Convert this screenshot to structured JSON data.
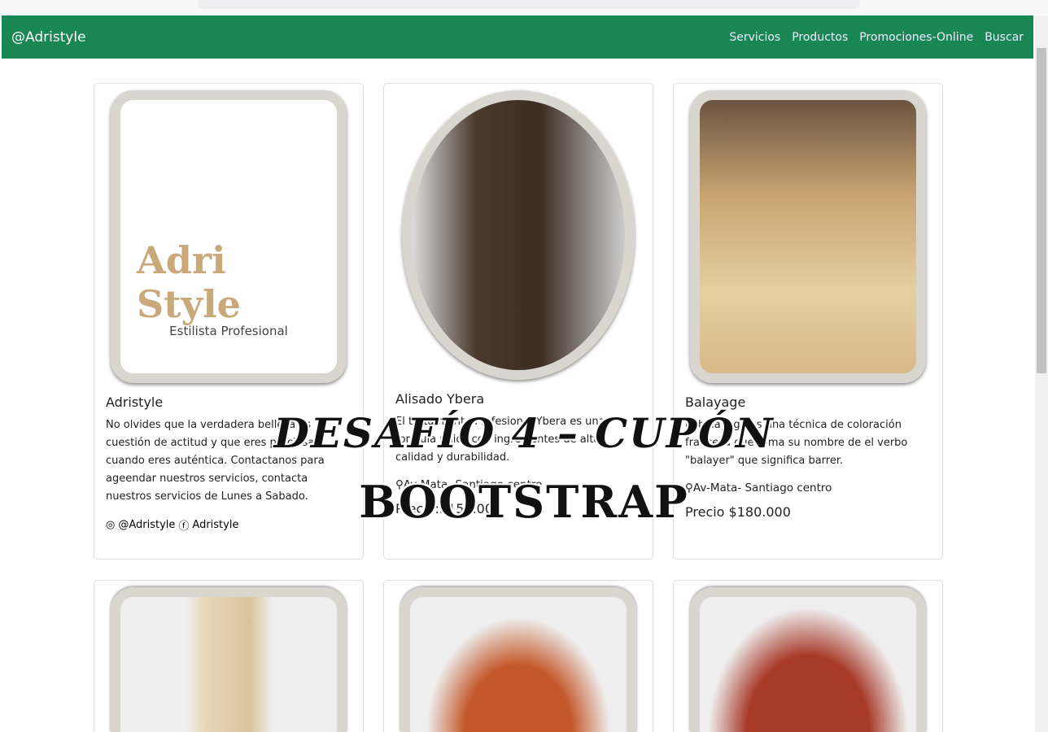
{
  "navbar": {
    "brand": "@Adristyle",
    "links": [
      "Servicios",
      "Productos",
      "Promociones-Online",
      "Buscar"
    ],
    "color": "#198754"
  },
  "cards": [
    {
      "title": "Adristyle",
      "text": "No olvides que la verdadera belleza es cuestión de actitud y que eres preciosa cuando eres auténtica. Contactanos para ageendar nuestros servicios, contacta nuestros servicios de Lunes a Sabado.",
      "instagram": "@Adristyle",
      "facebook": "Adristyle",
      "logo_text": "Adri Style",
      "logo_sub": "Estilista Profesional"
    },
    {
      "title": "Alisado Ybera",
      "text": "El tratamiento Profesional Ybera es una formula única con ingredientes de alta calidad y durabilidad.",
      "location": "Av-Mata- Santiago centro",
      "price": "Precio:$150.000"
    },
    {
      "title": "Balayage",
      "text": "El balayage es una técnica de coloración francesa que toma su nombre de el verbo \"balayer\" que significa barrer.",
      "location": "Av-Mata- Santiago centro",
      "price": "Precio $180.000"
    }
  ],
  "overlay": {
    "line1": "DESAFÍO 4 – CUPÓN",
    "line2": "BOOTSTRAP"
  }
}
